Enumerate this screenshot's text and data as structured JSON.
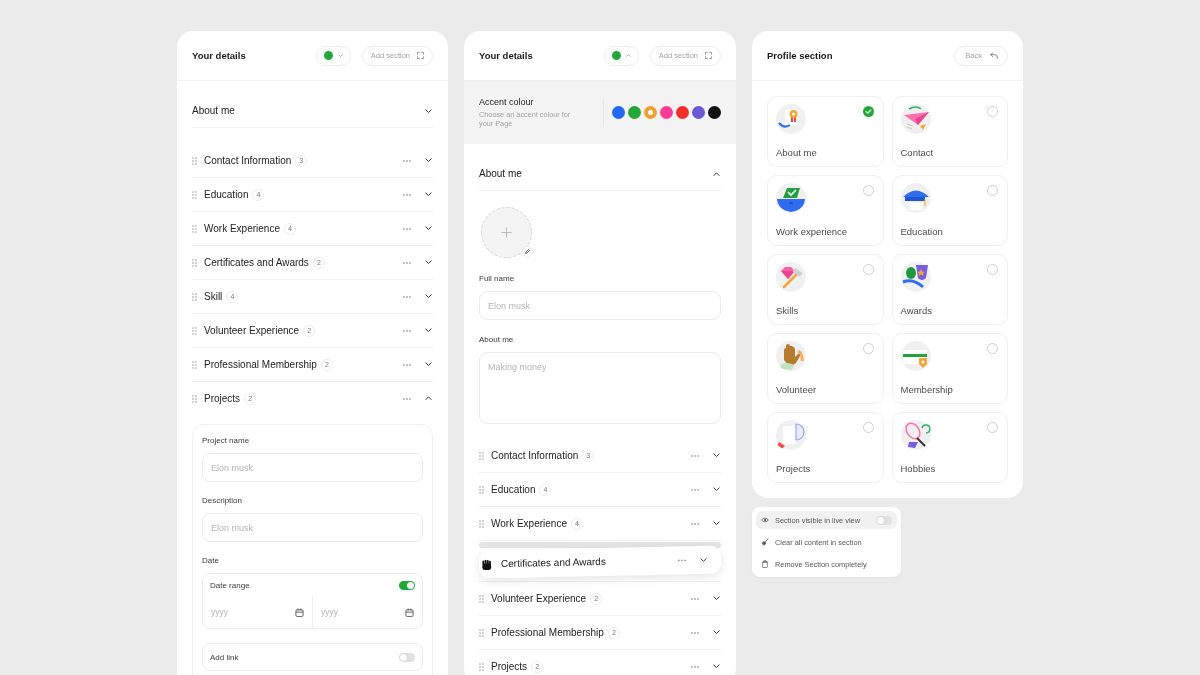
{
  "details_panels": [
    {
      "title": "Your details",
      "color_button": {
        "color": "#22a839",
        "expanded": false
      },
      "add_button": "Add section",
      "about": {
        "title": "About me",
        "expanded": false
      },
      "sections": [
        {
          "title": "Contact Information",
          "count": "3",
          "expanded": false,
          "dragging": false
        },
        {
          "title": "Education",
          "count": "4",
          "expanded": false,
          "dragging": false
        },
        {
          "title": "Work Experience",
          "count": "4",
          "expanded": false,
          "dragging": false
        },
        {
          "title": "Certificates and Awards",
          "count": "2",
          "expanded": false,
          "dragging": false
        },
        {
          "title": "Skill",
          "count": "4",
          "expanded": false,
          "dragging": false
        },
        {
          "title": "Volunteer Experience",
          "count": "2",
          "expanded": false,
          "dragging": false
        },
        {
          "title": "Professional Membership",
          "count": "2",
          "expanded": false,
          "dragging": false
        },
        {
          "title": "Projects",
          "count": "2",
          "expanded": true,
          "dragging": false,
          "form": {
            "fields": [
              {
                "label": "Project name",
                "placeholder": "Elon musk"
              },
              {
                "label": "Description",
                "placeholder": "Elon musk"
              }
            ],
            "date": {
              "label": "Date",
              "range_label": "Date range",
              "range_on": true,
              "start_placeholder": "yyyy",
              "end_placeholder": "yyyy"
            },
            "link": {
              "label": "Add link",
              "on": false
            }
          }
        }
      ]
    },
    {
      "title": "Your details",
      "color_button": {
        "color": "#22a839",
        "expanded": true
      },
      "add_button": "Add section",
      "accent": {
        "title": "Accent colour",
        "subtitle": "Choose an accent colour for your Page",
        "colors": [
          {
            "color": "#2468f2",
            "selected": false
          },
          {
            "color": "#22a839",
            "selected": false
          },
          {
            "color": "#f0a030",
            "selected": true
          },
          {
            "color": "#fa3c96",
            "selected": false
          },
          {
            "color": "#f52d2d",
            "selected": false
          },
          {
            "color": "#6a58d4",
            "selected": false
          },
          {
            "color": "#111111",
            "selected": false
          }
        ]
      },
      "about": {
        "title": "About me",
        "expanded": true,
        "fields": [
          {
            "kind": "input",
            "label": "Full name",
            "placeholder": "Elon musk"
          },
          {
            "kind": "textarea",
            "label": "About me",
            "placeholder": "Making money"
          }
        ]
      },
      "sections": [
        {
          "title": "Contact Information",
          "count": "3",
          "expanded": false,
          "dragging": false
        },
        {
          "title": "Education",
          "count": "4",
          "expanded": false,
          "dragging": false
        },
        {
          "title": "Work Experience",
          "count": "4",
          "expanded": false,
          "dragging": false
        },
        {
          "title": "Certificates and Awards",
          "expanded": false,
          "dragging": true
        },
        {
          "title": "Volunteer Experience",
          "count": "2",
          "expanded": false,
          "dragging": false
        },
        {
          "title": "Professional Membership",
          "count": "2",
          "expanded": false,
          "dragging": false
        },
        {
          "title": "Projects",
          "count": "2",
          "expanded": false,
          "dragging": false
        }
      ]
    }
  ],
  "profile_panel": {
    "title": "Profile section",
    "back_button": "Back",
    "cards": [
      {
        "label": "About me",
        "selected": true
      },
      {
        "label": "Contact",
        "selected": false
      },
      {
        "label": "Work experience",
        "selected": false
      },
      {
        "label": "Education",
        "selected": false
      },
      {
        "label": "Skills",
        "selected": false
      },
      {
        "label": "Awards",
        "selected": false
      },
      {
        "label": "Volunteer",
        "selected": false
      },
      {
        "label": "Membership",
        "selected": false
      },
      {
        "label": "Projects",
        "selected": false
      },
      {
        "label": "Hobbies",
        "selected": false
      }
    ]
  },
  "context_menu": {
    "items": [
      {
        "kind": "toggle",
        "label": "Section visible in live view",
        "selected": true,
        "on": false
      },
      {
        "kind": "action",
        "label": "Clear all content in section",
        "selected": false
      },
      {
        "kind": "action",
        "label": "Remove Section completely",
        "selected": false
      }
    ]
  }
}
